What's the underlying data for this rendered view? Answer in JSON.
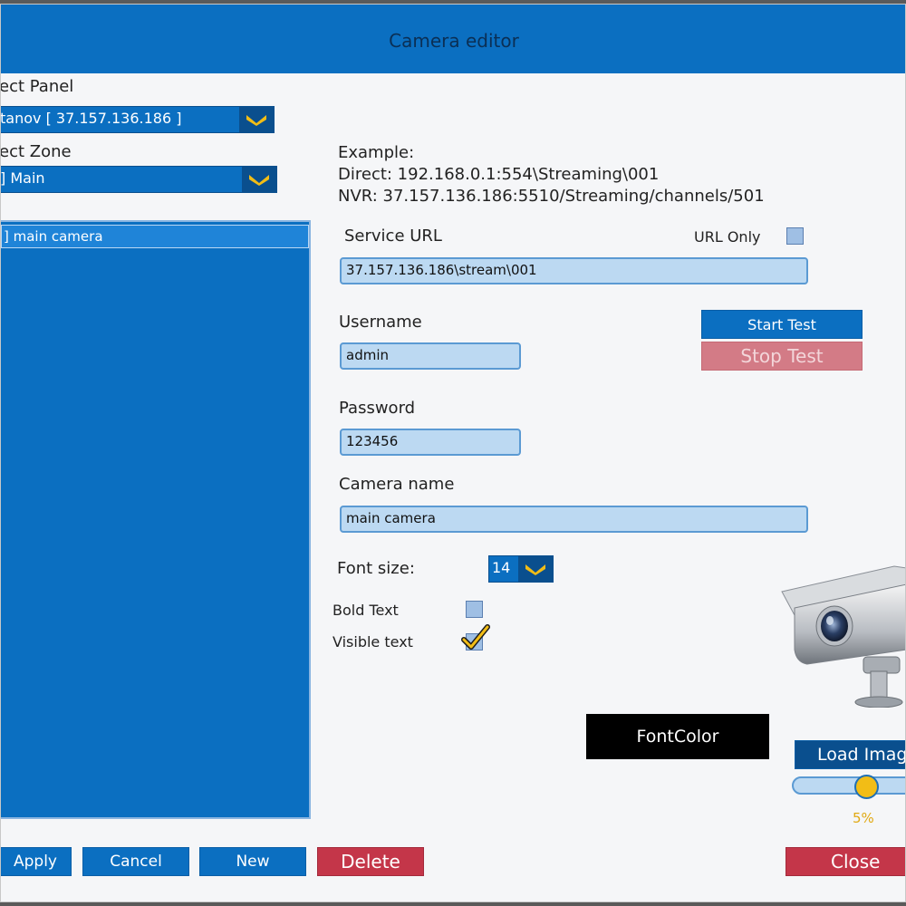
{
  "window": {
    "title": "Camera editor"
  },
  "panel": {
    "label": "ect Panel",
    "selected": "tanov [ 37.157.136.186 ]"
  },
  "zone": {
    "label": "ect Zone",
    "selected": "] Main"
  },
  "camera_list": {
    "items": [
      {
        "label": "] main camera"
      }
    ]
  },
  "example": {
    "title": "Example:",
    "direct": "Direct: 192.168.0.1:554\\Streaming\\001",
    "nvr": "NVR: 37.157.136.186:5510/Streaming/channels/501"
  },
  "service_url": {
    "label": "Service URL",
    "value": "37.157.136.186\\stream\\001",
    "url_only_label": "URL Only",
    "url_only_checked": false
  },
  "username": {
    "label": "Username",
    "value": "admin"
  },
  "password": {
    "label": "Password",
    "value": "123456"
  },
  "camera_name": {
    "label": "Camera name",
    "value": "main camera"
  },
  "test": {
    "start_label": "Start Test",
    "stop_label": "Stop Test"
  },
  "font": {
    "size_label": "Font size:",
    "size_value": "14",
    "bold_label": "Bold Text",
    "bold_checked": false,
    "visible_label": "Visible text",
    "visible_checked": true,
    "color_label": "FontColor"
  },
  "image": {
    "load_label": "Load Imag",
    "opacity_percent": 5,
    "opacity_label": "5%"
  },
  "actions": {
    "apply": "Apply",
    "cancel": "Cancel",
    "new": "New",
    "delete": "Delete",
    "close": "Close"
  },
  "colors": {
    "accent": "#0b6fc1",
    "danger": "#c43649",
    "slider_thumb": "#f2bd16"
  }
}
